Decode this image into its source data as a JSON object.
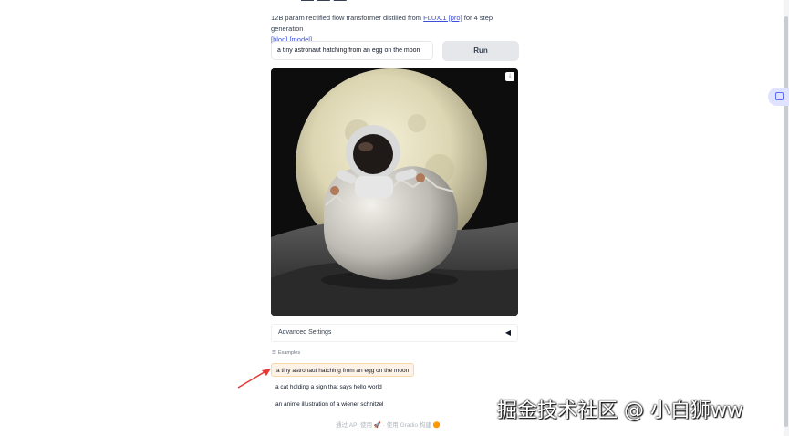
{
  "title_fragment": "— — —",
  "description": {
    "text_before": "12B param rectified flow transformer distilled from ",
    "link_flux": "FLUX.1 [pro]",
    "text_after": " for 4 step generation",
    "link_blog": "[blog]",
    "link_model": "[model]"
  },
  "prompt": {
    "value": "a tiny astronaut hatching from an egg on the moon"
  },
  "run_button": "Run",
  "advanced_settings": "Advanced Settings",
  "advanced_caret": "◀",
  "examples": {
    "label": "Examples",
    "items": [
      "a tiny astronaut hatching from an egg on the moon",
      "a cat holding a sign that says hello world",
      "an anime illustration of a wiener schnitzel"
    ]
  },
  "footer": "通过 API 使用 🚀 · 使用 Gradio 构建 🟠",
  "watermark": "掘金技术社区 @ 小白狮ww",
  "icons": {
    "download": "download-icon",
    "examples": "list-icon",
    "side_widget": "bookmark-icon"
  },
  "colors": {
    "link": "#3b4fd8",
    "active_example_bg": "#fef3e6",
    "arrow": "#e53935"
  }
}
